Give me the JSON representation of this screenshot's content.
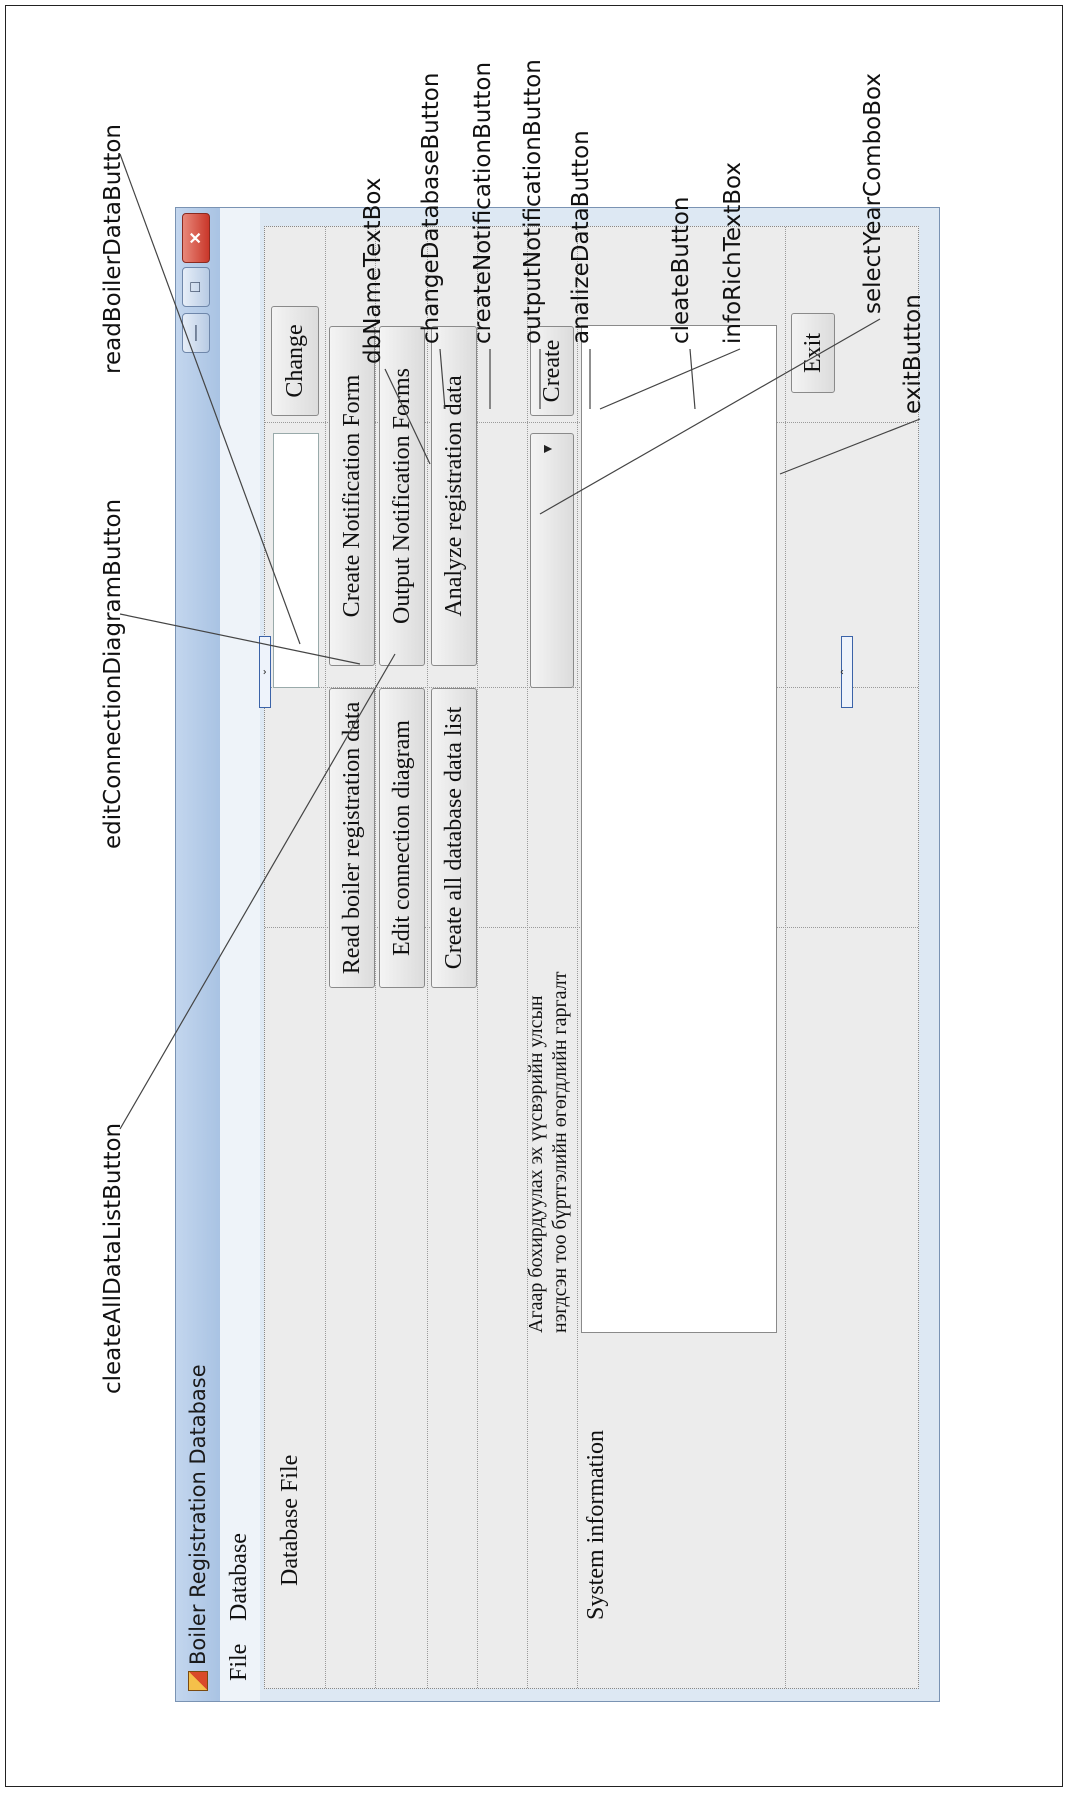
{
  "window": {
    "title": "Boiler Registration Database",
    "menu": [
      "File",
      "Database"
    ],
    "controls": {
      "minimize": "—",
      "maximize": "□",
      "close": "✕"
    }
  },
  "form": {
    "db_file_label": "Database File",
    "change_button": "Change",
    "read_boiler_button": "Read boiler registration data",
    "create_notification_button": "Create Notification Form",
    "edit_connection_button": "Edit connection diagram",
    "output_notification_button": "Output Notification Forms",
    "create_all_list_button": "Create all database data list",
    "analyze_button": "Analyze registration data",
    "mongolian_label_line1": "Агаар бохирдуулах эх үүсвэрийн улсын",
    "mongolian_label_line2": "нэгдсэн тоо бүртгэлийн өгөгдлийн гаргалт",
    "create_button": "Create",
    "system_info_label": "System information",
    "exit_button": "Exit"
  },
  "annotations": [
    "cleateAllDataListButton",
    "editConnectionDiagramButton",
    "readBoilerDataButton",
    "dbNameTextBox",
    "changeDatabaseButton",
    "createNotificationButton",
    "outputNotificationButton",
    "analizeDataButton",
    "cleateButton",
    "infoRichTextBox",
    "selectYearComboBox",
    "exitButton"
  ]
}
